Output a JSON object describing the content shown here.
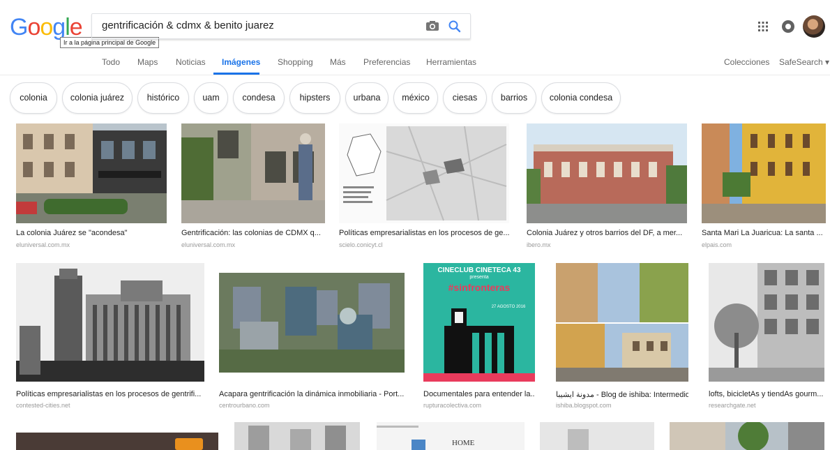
{
  "logo": {
    "letters": [
      "G",
      "o",
      "o",
      "g",
      "l",
      "e"
    ],
    "colors": [
      "#4285f4",
      "#ea4335",
      "#fbbc05",
      "#4285f4",
      "#34a853",
      "#ea4335"
    ]
  },
  "tooltip": "Ir a la página principal de Google",
  "search": {
    "value": "gentrificación & cdmx & benito juarez"
  },
  "tabs": [
    {
      "label": "Todo"
    },
    {
      "label": "Maps"
    },
    {
      "label": "Noticias"
    },
    {
      "label": "Imágenes"
    },
    {
      "label": "Shopping"
    },
    {
      "label": "Más"
    },
    {
      "label": "Preferencias"
    },
    {
      "label": "Herramientas"
    }
  ],
  "right_links": {
    "collections": "Colecciones",
    "safesearch": "SafeSearch ▾"
  },
  "chips": [
    "colonia",
    "colonia juárez",
    "histórico",
    "uam",
    "condesa",
    "hipsters",
    "urbana",
    "méxico",
    "ciesas",
    "barrios",
    "colonia condesa"
  ],
  "results": [
    {
      "caption": "La colonia Juárez se \"acondesa\"",
      "source": "eluniversal.com.mx"
    },
    {
      "caption": "Gentrificación: las colonias de CDMX q...",
      "source": "eluniversal.com.mx"
    },
    {
      "caption": "Políticas empresarialistas en los procesos de ge...",
      "source": "scielo.conicyt.cl"
    },
    {
      "caption": "Colonia Juárez y otros barrios del DF, a mer...",
      "source": "ibero.mx"
    },
    {
      "caption": "Santa Mari La Juaricua: La santa ...",
      "source": "elpais.com"
    },
    {
      "caption": "Políticas empresarialistas en los procesos de gentrifi...",
      "source": "contested-cities.net"
    },
    {
      "caption": "Acapara gentrificación la dinámica inmobiliaria - Port...",
      "source": "centrourbano.com"
    },
    {
      "caption": "Documentales para entender la...",
      "source": "rupturacolectiva.com"
    },
    {
      "caption": "مدونة ايشيبا - Blog de ishiba: Intermedio...",
      "source": "ishiba.blogspot.com"
    },
    {
      "caption": "lofts, bicicletAs y tiendAs gourm...",
      "source": "researchgate.net"
    }
  ],
  "poster": {
    "line1": "CINECLUB CINETECA 43",
    "line2": "presenta",
    "line3": "#sinfronteras",
    "date": "27 AGOSTO 2016"
  },
  "partial_thumb_text": "HOME"
}
